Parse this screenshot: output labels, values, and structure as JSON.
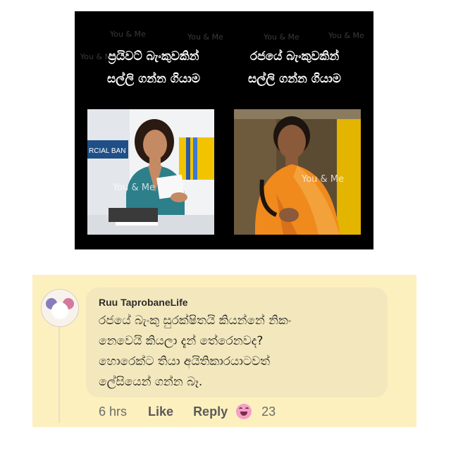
{
  "meme": {
    "left_caption": [
      "ප්‍රයිවට් බැංකුවකින්",
      "සල්ලි ගන්න ගියාම"
    ],
    "right_caption": [
      "රජයේ බැංකුවකින්",
      "සල්ලි ගන්න ගියාම"
    ],
    "watermark": "You & Me",
    "bank_sign": "RCIAL BAN"
  },
  "comment": {
    "author": "Ruu TaprobaneLife",
    "lines": [
      "රජයේ බැංකු සුරක්ෂිතයි කියන්නේ නිකං",
      "නෙවෙයි කියලා දැන් තේරෙනවද?",
      "හොරෙක්ට තියා අයිතිකාරයාටවත්",
      "ලේසියෙන් ගන්න බෑ."
    ],
    "time": "6 hrs",
    "like_label": "Like",
    "reply_label": "Reply",
    "reaction_icon": "haha-emoji-icon",
    "reaction_count": "23"
  },
  "colors": {
    "card_bg": "#fdf0bf",
    "bubble_bg": "#f3e8bd",
    "meme_bg": "#000000"
  }
}
